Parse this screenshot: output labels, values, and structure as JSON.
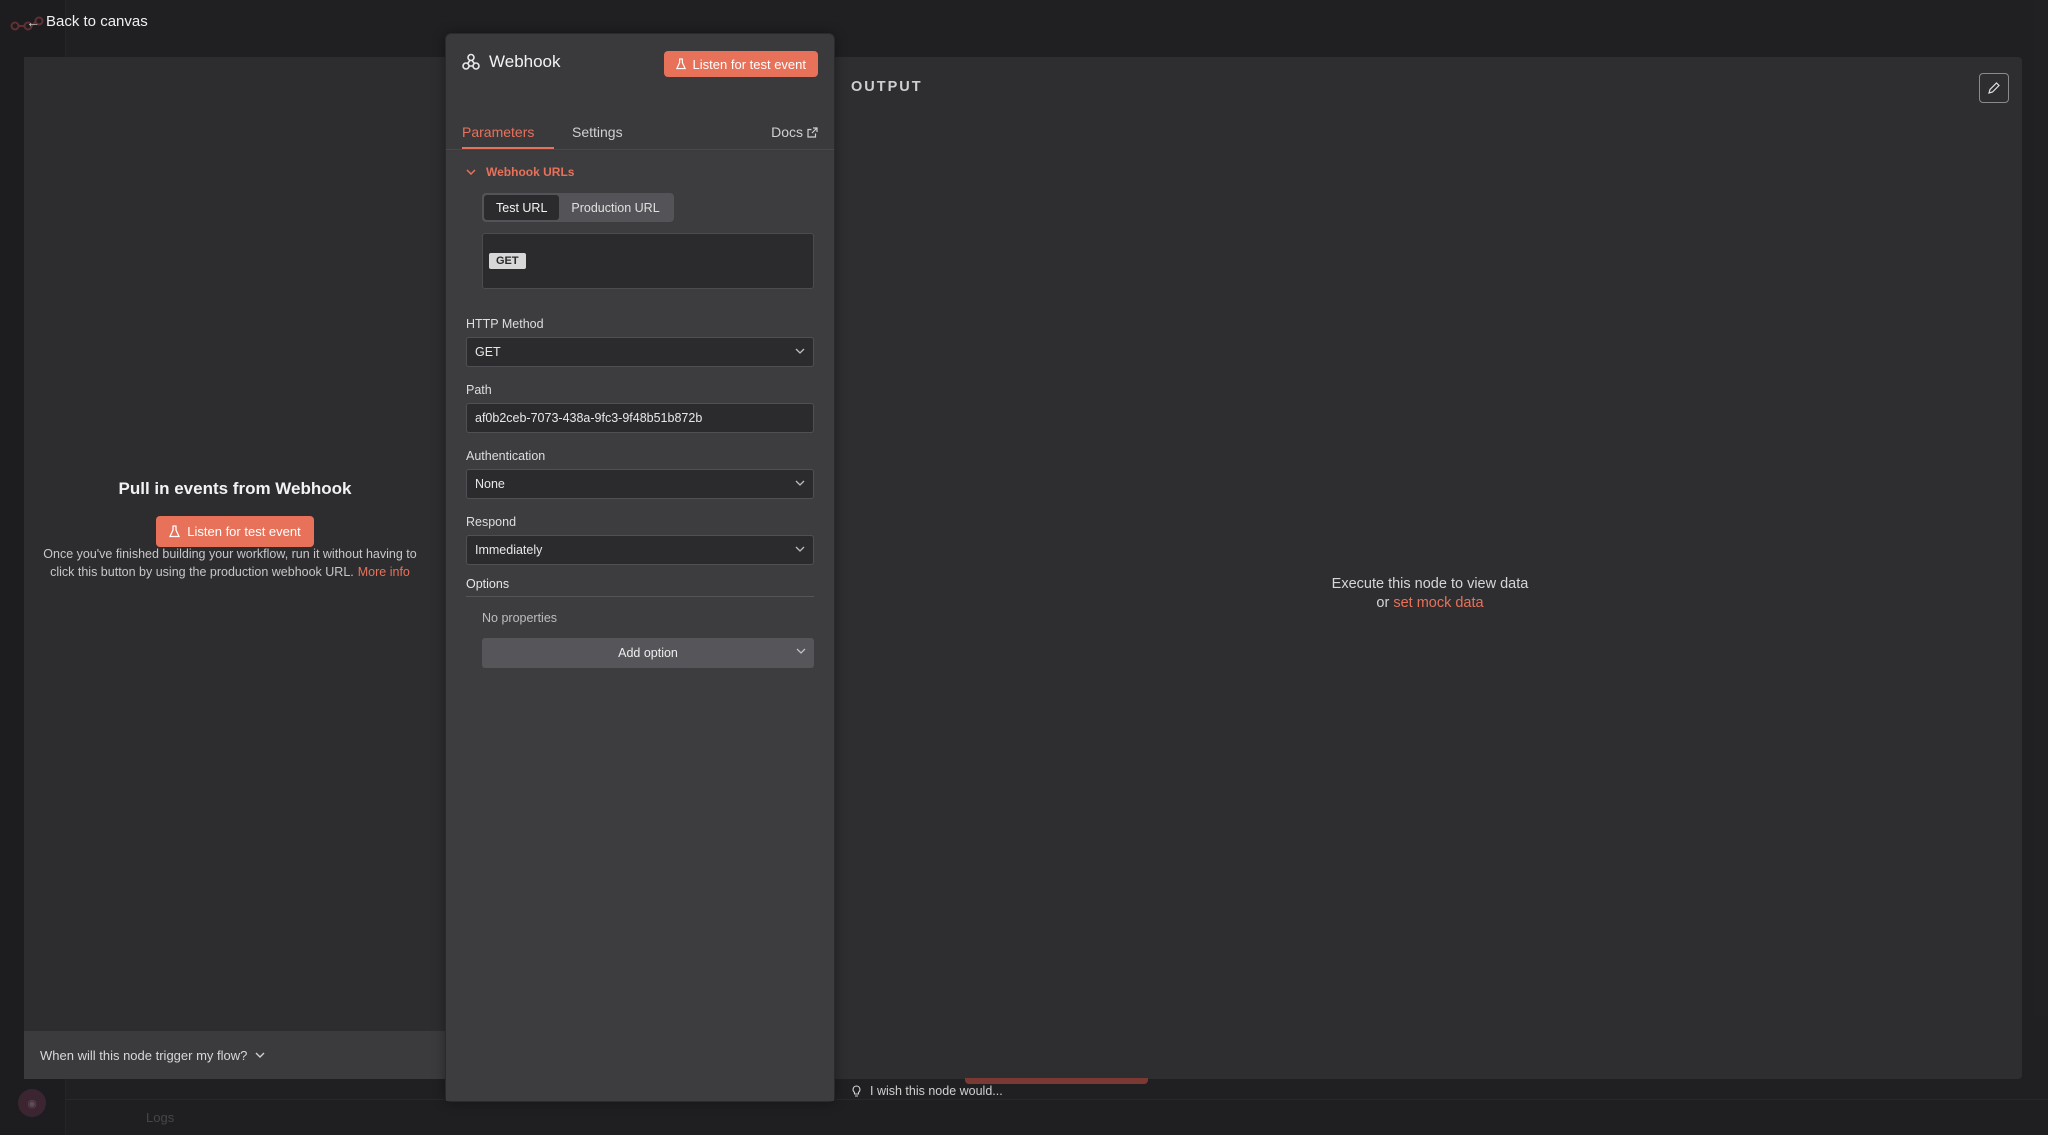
{
  "back": {
    "label": "Back to canvas"
  },
  "input_panel": {
    "title": "Pull in events from Webhook",
    "listen_label": "Listen for test event",
    "info_text": "Once you've finished building your workflow, run it without having to click this button by using the production webhook URL.",
    "more_info": "More info",
    "trigger_question": "When will this node trigger my flow?"
  },
  "node": {
    "title": "Webhook",
    "listen_label": "Listen for test event",
    "tabs": [
      {
        "label": "Parameters",
        "active": true
      },
      {
        "label": "Settings",
        "active": false
      }
    ],
    "docs_label": "Docs"
  },
  "webhook_urls": {
    "section_label": "Webhook URLs",
    "url_tabs": [
      {
        "label": "Test URL",
        "active": true
      },
      {
        "label": "Production URL",
        "active": false
      }
    ],
    "method_badge": "GET"
  },
  "fields": {
    "http_method": {
      "label": "HTTP Method",
      "value": "GET"
    },
    "path": {
      "label": "Path",
      "value": "af0b2ceb-7073-438a-9fc3-9f48b51b872b"
    },
    "authentication": {
      "label": "Authentication",
      "value": "None"
    },
    "respond": {
      "label": "Respond",
      "value": "Immediately"
    }
  },
  "options": {
    "label": "Options",
    "empty_text": "No properties",
    "add_label": "Add option"
  },
  "output": {
    "label": "OUTPUT",
    "message": "Execute this node to view data",
    "or": "or",
    "mock_link": "set mock data"
  },
  "wish": {
    "label": "I wish this node would..."
  },
  "bottom_bar": {
    "logs": "Logs"
  },
  "colors": {
    "accent": "#e8715a",
    "panel": "#3d3d40",
    "background": "#2e2e30"
  }
}
